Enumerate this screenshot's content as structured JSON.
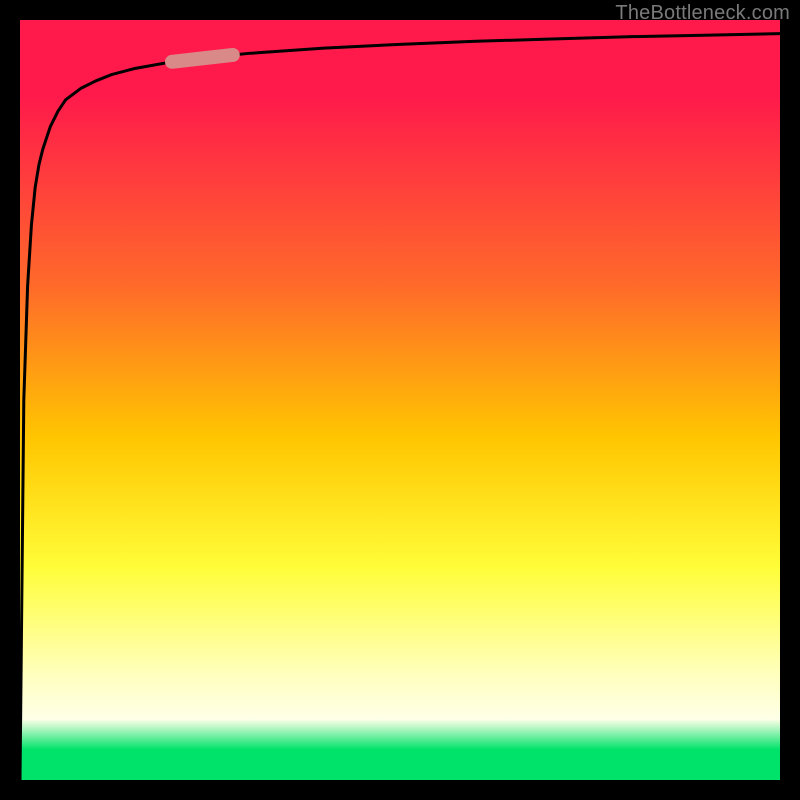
{
  "watermark": "TheBottleneck.com",
  "colors": {
    "frame": "#000000",
    "curve": "#000000",
    "marker": "#d98a88"
  },
  "chart_data": {
    "type": "line",
    "title": "",
    "xlabel": "",
    "ylabel": "",
    "xlim": [
      0,
      100
    ],
    "ylim": [
      0,
      100
    ],
    "grid": false,
    "legend": false,
    "series": [
      {
        "name": "curve",
        "x": [
          0,
          0.5,
          1,
          1.5,
          2,
          2.5,
          3,
          4,
          5,
          6,
          8,
          10,
          12,
          15,
          20,
          25,
          30,
          40,
          50,
          60,
          70,
          80,
          90,
          100
        ],
        "y": [
          0,
          50,
          65,
          73,
          78,
          81,
          83,
          86,
          88,
          89.5,
          91,
          92,
          92.8,
          93.6,
          94.5,
          95.1,
          95.6,
          96.3,
          96.8,
          97.2,
          97.5,
          97.8,
          98,
          98.2
        ]
      }
    ],
    "marker": {
      "series": "curve",
      "x_range": [
        20,
        28
      ],
      "note": "highlighted segment on curve"
    },
    "background_gradient": {
      "direction": "vertical",
      "stops": [
        {
          "pos": 0.0,
          "color": "#ff1a4b"
        },
        {
          "pos": 0.35,
          "color": "#ff6a2a"
        },
        {
          "pos": 0.55,
          "color": "#ffc600"
        },
        {
          "pos": 0.72,
          "color": "#fffd38"
        },
        {
          "pos": 0.92,
          "color": "#ffffe8"
        },
        {
          "pos": 0.96,
          "color": "#00e36a"
        },
        {
          "pos": 1.0,
          "color": "#00e36a"
        }
      ]
    }
  }
}
